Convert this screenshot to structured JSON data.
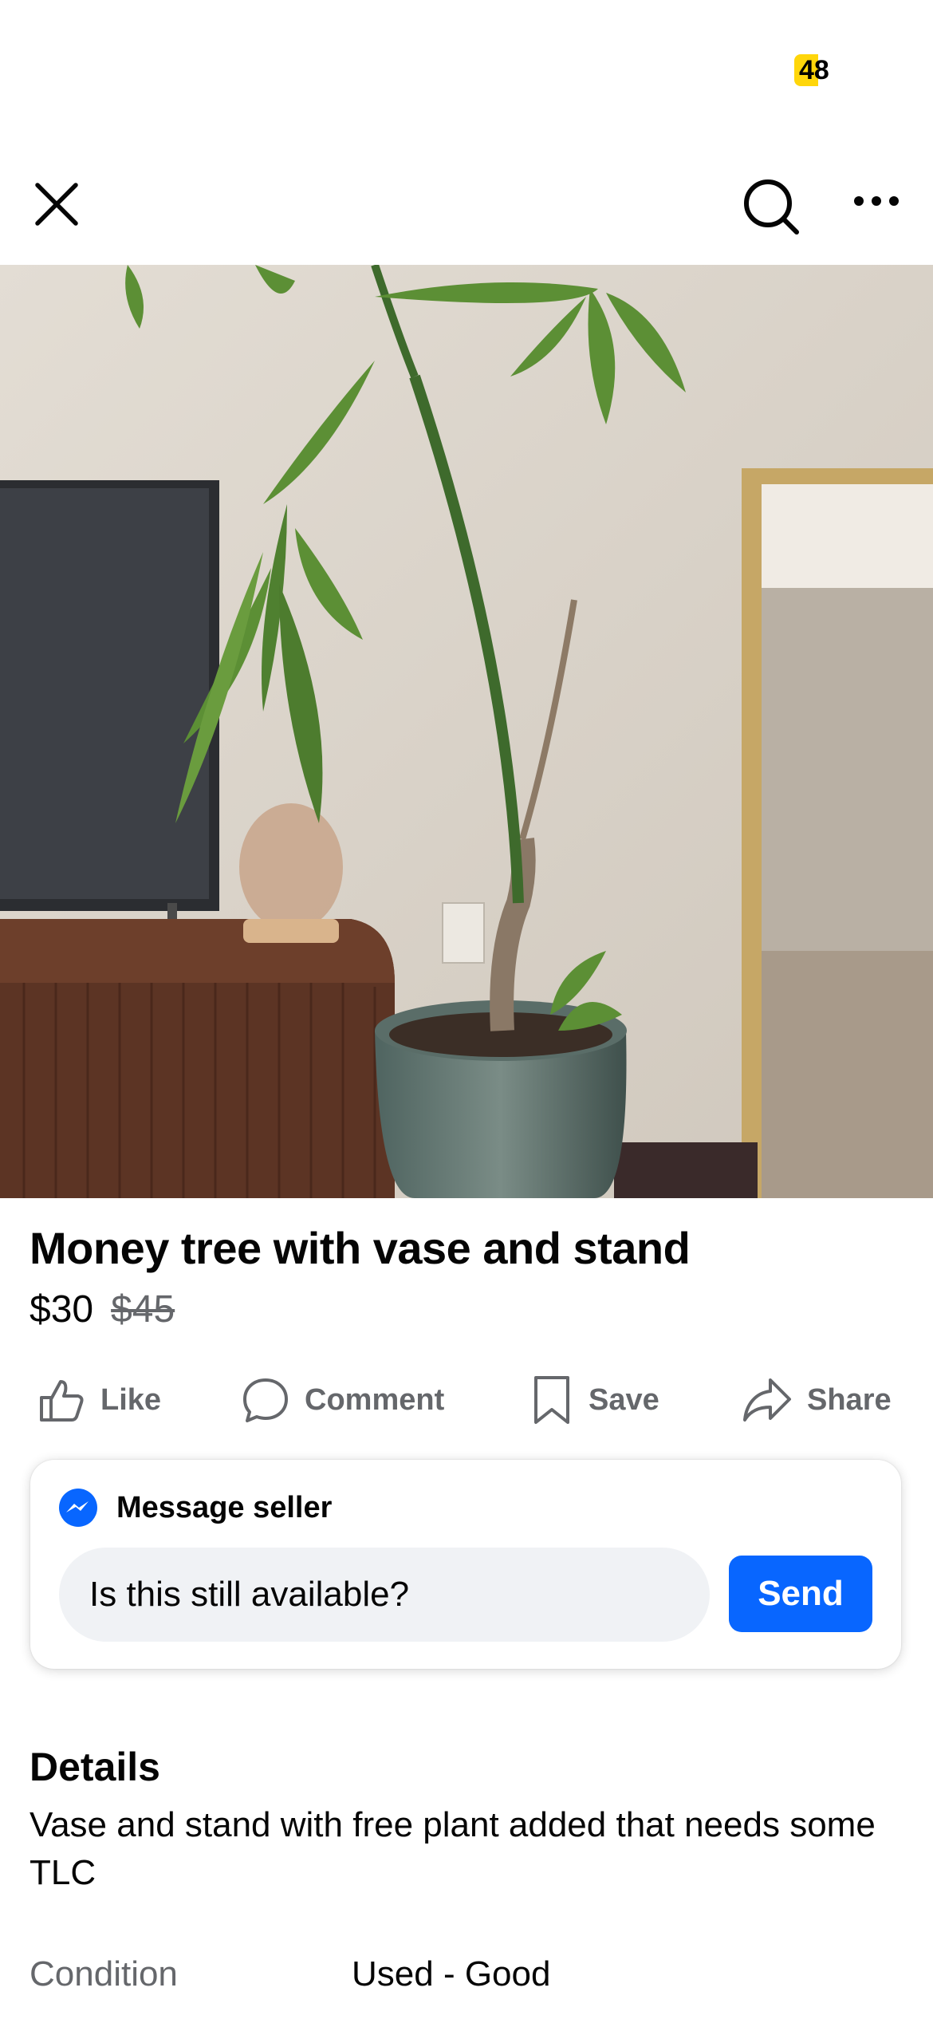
{
  "status_bar": {
    "battery": "48",
    "battery_color": "#ffd60a"
  },
  "topbar": {
    "close_icon": "close-icon",
    "search_icon": "search-icon",
    "more_icon": "more-dots-icon"
  },
  "listing": {
    "title": "Money tree with vase and stand",
    "price": "$30",
    "original_price": "$45"
  },
  "actions": [
    {
      "label": "Like",
      "icon": "thumbs-up-icon"
    },
    {
      "label": "Comment",
      "icon": "comment-icon"
    },
    {
      "label": "Save",
      "icon": "bookmark-icon"
    },
    {
      "label": "Share",
      "icon": "share-icon"
    }
  ],
  "message": {
    "heading": "Message seller",
    "input_value": "Is this still available?",
    "send_label": "Send",
    "accent_color": "#0866ff"
  },
  "details": {
    "heading": "Details",
    "description": "Vase and stand with free plant added that needs some TLC",
    "condition_label": "Condition",
    "condition_value": "Used - Good"
  }
}
